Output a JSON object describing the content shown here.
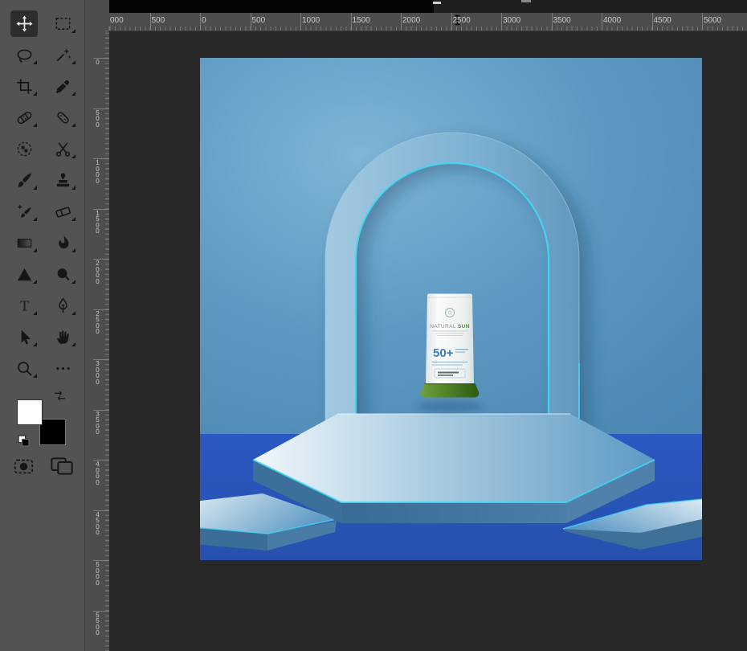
{
  "toolbar": {
    "foreground_color": "#ffffff",
    "background_color": "#000000",
    "tools": [
      {
        "name": "move-tool",
        "icon": "move",
        "selected": true,
        "flyout": false
      },
      {
        "name": "rectangular-marquee-tool",
        "icon": "marquee",
        "selected": false,
        "flyout": true
      },
      {
        "name": "lasso-tool",
        "icon": "lasso",
        "selected": false,
        "flyout": true
      },
      {
        "name": "magic-wand-tool",
        "icon": "magicwand",
        "selected": false,
        "flyout": true
      },
      {
        "name": "crop-tool",
        "icon": "crop",
        "selected": false,
        "flyout": true
      },
      {
        "name": "eyedropper-tool",
        "icon": "eyedropper",
        "selected": false,
        "flyout": true
      },
      {
        "name": "healing-brush-tool",
        "icon": "healing",
        "selected": false,
        "flyout": true
      },
      {
        "name": "patch-tool",
        "icon": "patch",
        "selected": false,
        "flyout": true
      },
      {
        "name": "pattern-select-tool",
        "icon": "patternselect",
        "selected": false,
        "flyout": false
      },
      {
        "name": "scissors-tool",
        "icon": "scissors",
        "selected": false,
        "flyout": true
      },
      {
        "name": "paintbrush-tool",
        "icon": "paintbrush",
        "selected": false,
        "flyout": true
      },
      {
        "name": "clone-stamp-tool",
        "icon": "clonestamp",
        "selected": false,
        "flyout": true
      },
      {
        "name": "mixer-brush-tool",
        "icon": "mixerbrush",
        "selected": false,
        "flyout": true
      },
      {
        "name": "eraser-tool",
        "icon": "eraser",
        "selected": false,
        "flyout": true
      },
      {
        "name": "gradient-tool",
        "icon": "gradient",
        "selected": false,
        "flyout": true
      },
      {
        "name": "smudge-tool",
        "icon": "smudge",
        "selected": false,
        "flyout": true
      },
      {
        "name": "shape-tool",
        "icon": "triangle",
        "selected": false,
        "flyout": true
      },
      {
        "name": "dodge-tool",
        "icon": "dodge",
        "selected": false,
        "flyout": true
      },
      {
        "name": "type-tool",
        "icon": "type",
        "selected": false,
        "flyout": true
      },
      {
        "name": "pen-tool",
        "icon": "pen",
        "selected": false,
        "flyout": true
      },
      {
        "name": "path-select-tool",
        "icon": "pathselect",
        "selected": false,
        "flyout": true
      },
      {
        "name": "hand-tool",
        "icon": "hand",
        "selected": false,
        "flyout": true
      },
      {
        "name": "zoom-tool",
        "icon": "zoom",
        "selected": false,
        "flyout": true
      },
      {
        "name": "more-tools",
        "icon": "ellipsis",
        "selected": false,
        "flyout": false
      }
    ]
  },
  "rulers": {
    "horizontal": {
      "labels": [
        "000",
        "500",
        "0",
        "500",
        "1000",
        "1500",
        "2000",
        "2500",
        "3000",
        "3500",
        "4000",
        "4500",
        "5000"
      ]
    },
    "vertical": {
      "labels": [
        "0",
        "500",
        "1000",
        "1500",
        "2000",
        "2500",
        "3000",
        "3500",
        "4000",
        "4500",
        "5000",
        "5500"
      ]
    }
  },
  "artwork": {
    "product": {
      "brand_prefix": "NATURAL ",
      "brand_suffix": "SUN",
      "spf": "50+"
    },
    "colors": {
      "sky_light": "#7fb5d6",
      "sky": "#5c98c1",
      "sky_dark": "#4b87b2",
      "floor": "#2b58c2",
      "floor_dark": "#2750ae",
      "arch_light": "#a3c9e0",
      "arch_mid": "#7fb2d3",
      "arch_dark": "#6298bd",
      "cyan": "#41d8f5",
      "podium_top_light": "#f0f7fb",
      "podium_top_dark": "#5e9ac4",
      "podium_side": "#4c7ea7",
      "podium_side_dark": "#3a6b95",
      "slab_light": "#dcebf3",
      "slab_blue": "#5f9ac4",
      "cap_light": "#6fa13c",
      "cap_dark": "#2f5a10",
      "spf_blue": "#3d7fb7",
      "sun_green": "#4f8f3e",
      "label_gray": "#7e8e8e",
      "shadow_navy": "#16386b"
    }
  }
}
